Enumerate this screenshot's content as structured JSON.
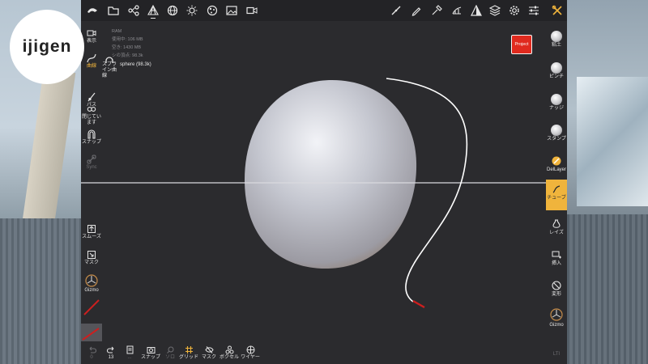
{
  "logo": {
    "text": "ijigen"
  },
  "stats": {
    "ram": "RAM",
    "used": "使用中: 106 MB",
    "free": "空き: 1430 MB",
    "vertices": "シの頂点: 98.3k"
  },
  "project_button": "Project",
  "left_tools": {
    "camera": "表示",
    "curve": "曲線",
    "spline": "スプライン曲線",
    "sphere": "sphere (98.3k)",
    "path": "パス",
    "closed": "閉じています",
    "snap": "スナップ",
    "sync": "Sync",
    "smooth": "スムーズ",
    "mask": "マスク",
    "gizmo": "Gizmo"
  },
  "right_tools": {
    "clay": "粘土",
    "pinch": "ピンチ",
    "nudge": "ナッジ",
    "stamp": "スタンプ",
    "dellayer": "DelLayer",
    "tube": "チューブ",
    "lathe": "レイズ",
    "insert": "挿入",
    "transform": "変形",
    "gizmo": "Gizmo",
    "lti": "LTI"
  },
  "bottom_tools": {
    "undo": "0",
    "redo": "13",
    "tool3": "...",
    "snap": "スナップ",
    "tool5": "ソロ",
    "grid": "グリッド",
    "mask": "マスク",
    "voxel": "ボクセル",
    "wire": "ワイヤー"
  },
  "colors": {
    "accent": "#f0b43c",
    "project": "#e02a1e",
    "curve": "#ffffff",
    "curve_tip": "#cc1f1f"
  }
}
